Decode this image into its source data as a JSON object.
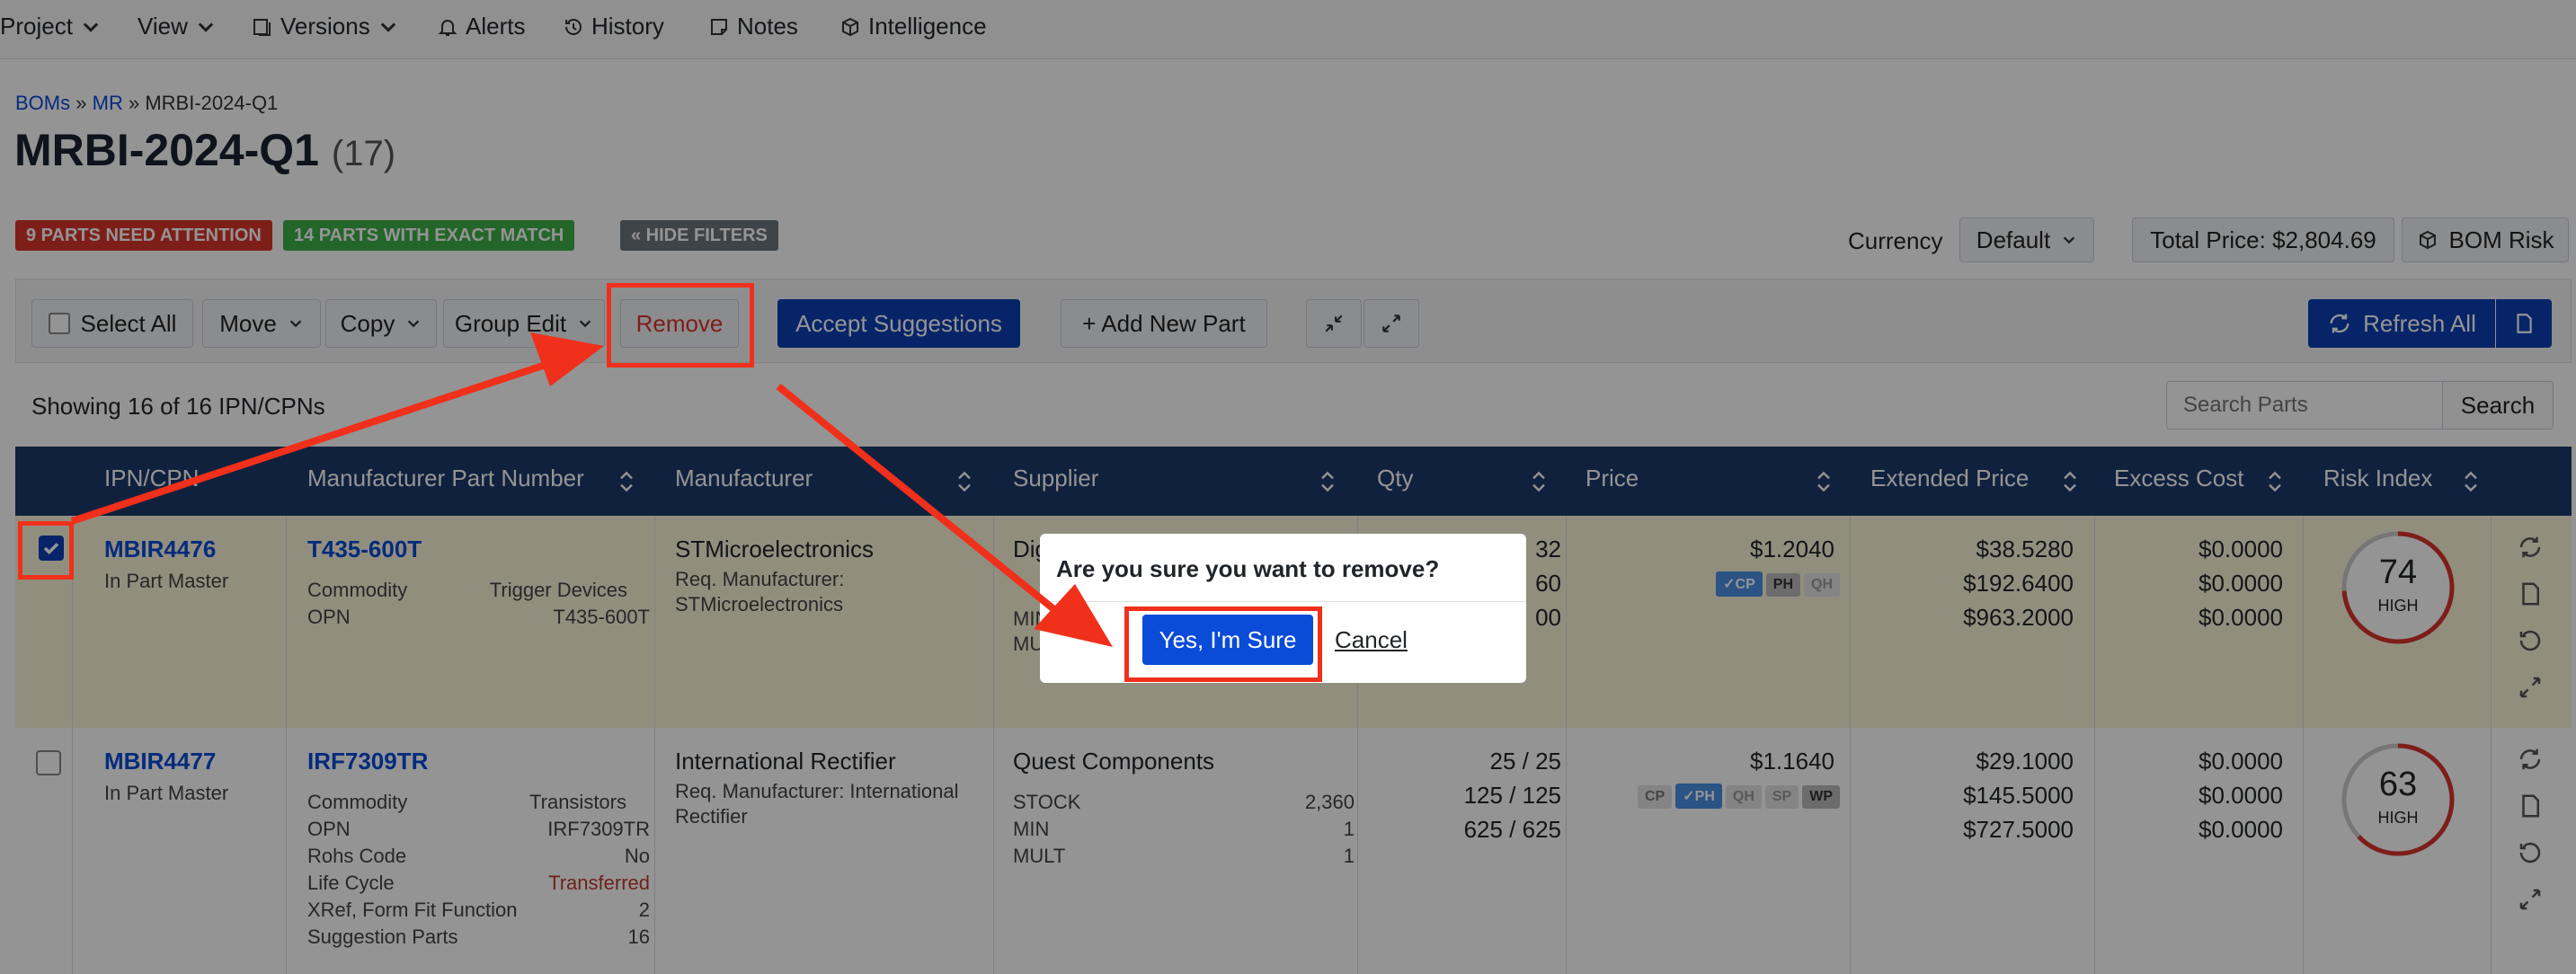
{
  "nav": {
    "items": [
      {
        "label": "Project",
        "icon": "",
        "dropdown": true
      },
      {
        "label": "View",
        "icon": "",
        "dropdown": true
      },
      {
        "label": "Versions",
        "icon": "versions-icon",
        "dropdown": true
      },
      {
        "label": "Alerts",
        "icon": "bell-icon",
        "dropdown": false
      },
      {
        "label": "History",
        "icon": "history-icon",
        "dropdown": false
      },
      {
        "label": "Notes",
        "icon": "notes-icon",
        "dropdown": false
      },
      {
        "label": "Intelligence",
        "icon": "cube-icon",
        "dropdown": false
      }
    ]
  },
  "breadcrumb": {
    "boms": "BOMs",
    "sep": "»",
    "mr": "MR",
    "current": "MRBI-2024-Q1"
  },
  "page": {
    "title": "MRBI-2024-Q1",
    "count": "(17)"
  },
  "badges": {
    "attention": "9 PARTS NEED ATTENTION",
    "exact": "14 PARTS WITH EXACT MATCH",
    "hide_filters": "« HIDE FILTERS"
  },
  "summary": {
    "currency_label": "Currency",
    "currency_value": "Default",
    "total_price": "Total Price: $2,804.69",
    "bom_risk": "BOM Risk"
  },
  "toolbar": {
    "select_all": "Select All",
    "move": "Move",
    "copy": "Copy",
    "group_edit": "Group Edit",
    "remove": "Remove",
    "accept": "Accept Suggestions",
    "add_part": "+ Add New Part",
    "refresh_all": "Refresh All"
  },
  "list": {
    "showing": "Showing 16 of 16 IPN/CPNs",
    "search_placeholder": "Search Parts",
    "search_button": "Search"
  },
  "columns": [
    "IPN/CPN",
    "Manufacturer Part Number",
    "Manufacturer",
    "Supplier",
    "Qty",
    "Price",
    "Extended Price",
    "Excess Cost",
    "Risk Index"
  ],
  "rows": [
    {
      "ipn": "MBIR4476",
      "ipn_status": "In Part Master",
      "checked": true,
      "mpn": "T435-600T",
      "commodity_label": "Commodity",
      "commodity_value": "Trigger Devices",
      "opn_label": "OPN",
      "opn_value": "T435-600T",
      "manufacturer": "STMicroelectronics",
      "req_manufacturer": "Req. Manufacturer:",
      "req_manufacturer_value": "STMicroelectronics",
      "supplier": "Dig",
      "supplier_min": "MIN",
      "supplier_mult": "MU",
      "qty": [
        "32",
        "60",
        "00"
      ],
      "price": "$1.2040",
      "chips": [
        "✓CP",
        "PH",
        "QH"
      ],
      "extended": [
        "$38.5280",
        "$192.6400",
        "$963.2000"
      ],
      "excess": [
        "$0.0000",
        "$0.0000",
        "$0.0000"
      ],
      "risk_value": "74",
      "risk_label": "HIGH",
      "risk_fraction": 0.74
    },
    {
      "ipn": "MBIR4477",
      "ipn_status": "In Part Master",
      "checked": false,
      "mpn": "IRF7309TR",
      "commodity_label": "Commodity",
      "commodity_value": "Transistors",
      "opn_label": "OPN",
      "opn_value": "IRF7309TR",
      "rohs_label": "Rohs Code",
      "rohs_value": "No",
      "lifecycle_label": "Life Cycle",
      "lifecycle_value": "Transferred",
      "xref_label": "XRef, Form Fit Function",
      "xref_value": "2",
      "suggestion_label": "Suggestion Parts",
      "suggestion_value": "16",
      "manufacturer": "International Rectifier",
      "req_manufacturer": "Req. Manufacturer: International",
      "req_manufacturer_value": "Rectifier",
      "supplier": "Quest Components",
      "stock_label": "STOCK",
      "stock_value": "2,360",
      "min_label": "MIN",
      "min_value": "1",
      "mult_label": "MULT",
      "mult_value": "1",
      "qty": [
        "25 / 25",
        "125 / 125",
        "625 / 625"
      ],
      "price": "$1.1640",
      "chips": [
        "CP",
        "✓PH",
        "QH",
        "SP",
        "WP"
      ],
      "extended": [
        "$29.1000",
        "$145.5000",
        "$727.5000"
      ],
      "excess": [
        "$0.0000",
        "$0.0000",
        "$0.0000"
      ],
      "risk_value": "63",
      "risk_label": "HIGH",
      "risk_fraction": 0.63
    }
  ],
  "modal": {
    "question": "Are you sure you want to remove?",
    "confirm": "Yes, I'm Sure",
    "cancel": "Cancel"
  },
  "colors": {
    "primary": "#0d3fb3",
    "header": "#1d3a6b",
    "danger": "#d9342b",
    "success": "#3fae49",
    "annotation": "#f0301a",
    "highlight_row": "#fbf5d9"
  }
}
